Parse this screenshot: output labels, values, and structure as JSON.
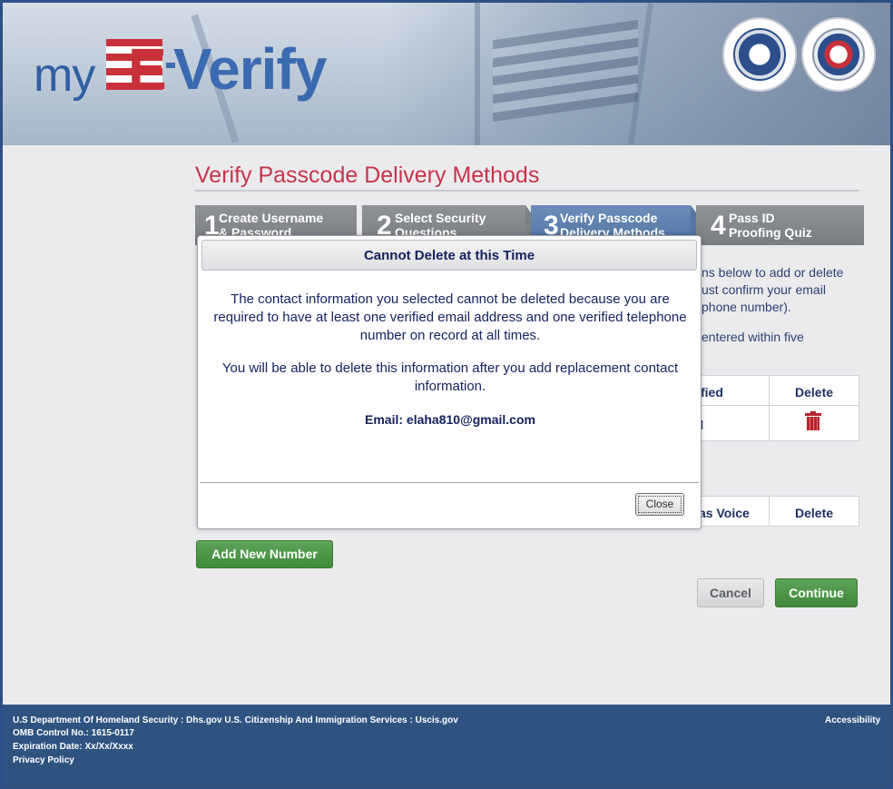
{
  "header": {
    "logo_text": "my E-Verify",
    "logo_my": "my",
    "logo_e": "E",
    "logo_verify": "Verify",
    "seals": [
      "U.S. Department of Homeland Security",
      "Social Security Administration"
    ]
  },
  "page": {
    "title": "Verify Passcode Delivery Methods"
  },
  "steps": [
    {
      "num": "1",
      "label_line1": "Create Username",
      "label_line2": "& Password",
      "active": false
    },
    {
      "num": "2",
      "label_line1": "Select Security",
      "label_line2": "Questions",
      "active": false
    },
    {
      "num": "3",
      "label_line1": "Verify Passcode",
      "label_line2": "Delivery Methods",
      "active": true
    },
    {
      "num": "4",
      "label_line1": "Pass ID",
      "label_line2": "Proofing Quiz",
      "active": false
    }
  ],
  "background_text": {
    "line1": "ns below to add or delete",
    "line2": "ust confirm your email",
    "line3": "phone number).",
    "line4": "entered within five"
  },
  "email_table": {
    "col_verified": "fied",
    "col_delete": "Delete",
    "row_value": "l"
  },
  "phone_table": {
    "col_voice": "as Voice",
    "col_delete": "Delete"
  },
  "buttons": {
    "add_new_number": "Add New Number",
    "cancel": "Cancel",
    "continue": "Continue"
  },
  "modal": {
    "title": "Cannot Delete at this Time",
    "para1": "The contact information you selected cannot be deleted because you are required to have at least one verified email address and one verified telephone number on record at all times.",
    "para2": "You will be able to delete this information after you add replacement contact information.",
    "email_line": "Email: elaha810@gmail.com",
    "close_label": "Close"
  },
  "footer": {
    "line1": "U.S Department Of Homeland Security : Dhs.gov    U.S. Citizenship And Immigration Services : Uscis.gov",
    "line2": "OMB Control No.: 1615-0117",
    "line3": "Expiration Date: Xx/Xx/Xxxx",
    "line4": "Privacy Policy",
    "accessibility": "Accessibility"
  },
  "colors": {
    "title_red": "#c8334b",
    "step_active": "#4f73a3",
    "button_green": "#4a9246",
    "footer_blue": "#2f5380",
    "modal_text": "#14215f"
  }
}
